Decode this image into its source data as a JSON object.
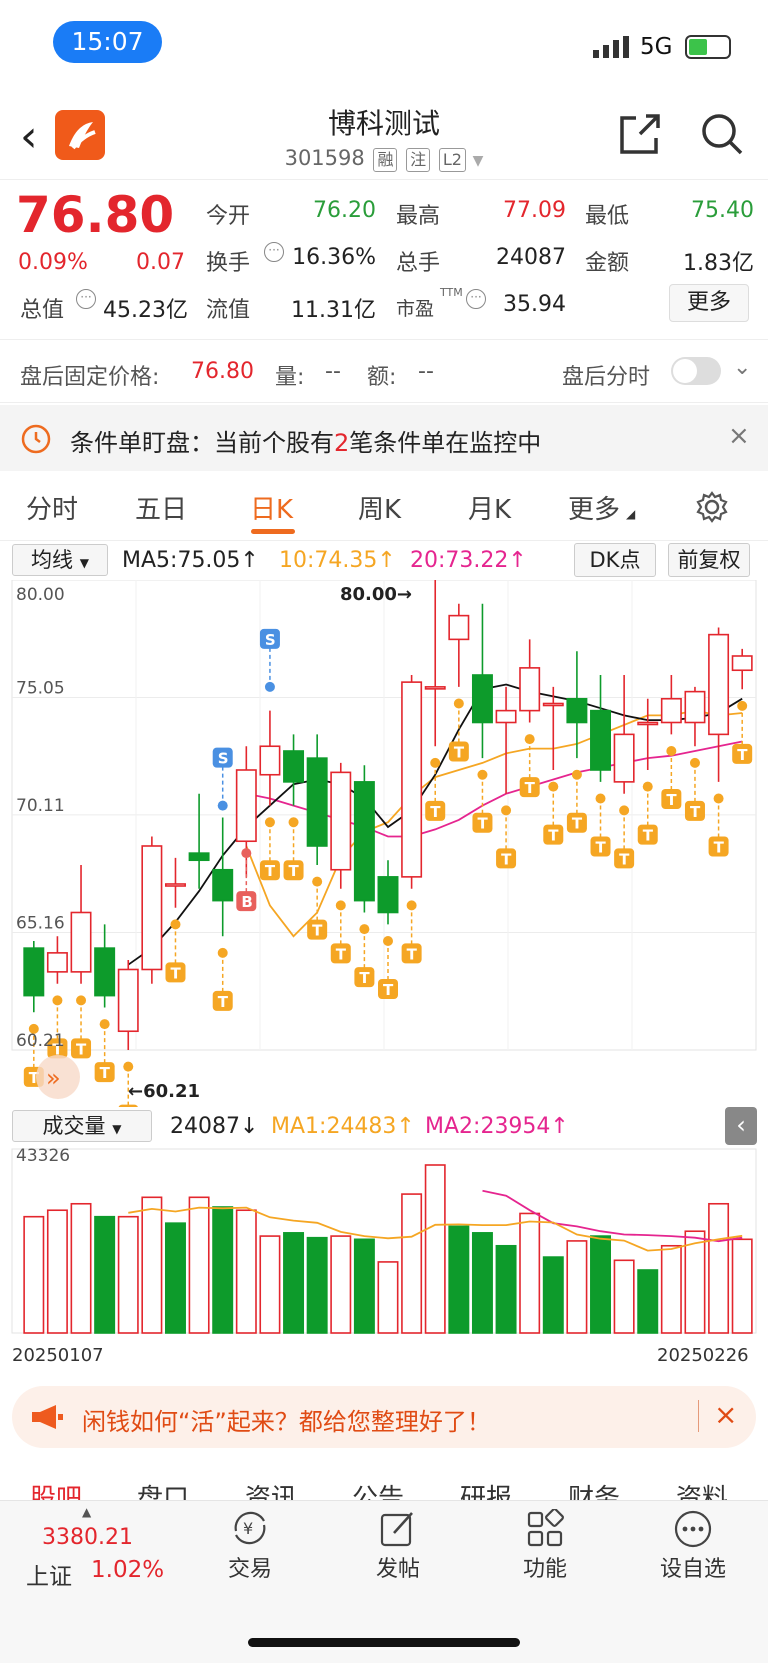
{
  "status_bar": {
    "time": "15:07",
    "network": "5G"
  },
  "header": {
    "title": "博科测试",
    "code": "301598",
    "tags": [
      "融",
      "注",
      "L2"
    ]
  },
  "quote": {
    "price": "76.80",
    "change_pct": "0.09%",
    "change": "0.07",
    "rows": [
      [
        {
          "label": "今开",
          "value": "76.20",
          "color": "#2a9d3a"
        },
        {
          "label": "最高",
          "value": "77.09",
          "color": "#e3262d"
        },
        {
          "label": "最低",
          "value": "75.40",
          "color": "#2a9d3a"
        }
      ],
      [
        {
          "label": "换手",
          "value": "16.36%",
          "color": "#222"
        },
        {
          "label": "总手",
          "value": "24087",
          "color": "#222"
        },
        {
          "label": "金额",
          "value": "1.83亿",
          "color": "#222"
        }
      ],
      [
        {
          "label": "总值",
          "value": "45.23亿",
          "color": "#222"
        },
        {
          "label": "流值",
          "value": "11.31亿",
          "color": "#222"
        },
        {
          "label": "市盈",
          "value": "35.94",
          "color": "#222"
        }
      ]
    ],
    "pe_sup": "TTM",
    "more_label": "更多"
  },
  "after_hours": {
    "label": "盘后固定价格:",
    "price": "76.80",
    "vol_label": "量:",
    "vol": "--",
    "amt_label": "额:",
    "amt": "--",
    "intraday_label": "盘后分时"
  },
  "alert": {
    "prefix": "条件单盯盘：当前个股有",
    "count": "2",
    "suffix": "笔条件单在监控中"
  },
  "tabs": [
    "分时",
    "五日",
    "日K",
    "周K",
    "月K",
    "更多"
  ],
  "active_tab": "日K",
  "ma_row": {
    "type": "均线",
    "ma5": "MA5:75.05↑",
    "ma10": "10:74.35↑",
    "ma20": "20:73.22↑",
    "dk": "DK点",
    "adjust": "前复权"
  },
  "vol_row": {
    "type": "成交量",
    "vol": "24087↓",
    "ma1": "MA1:24483↑",
    "ma2": "MA2:23954↑"
  },
  "chart_data": {
    "type": "candlestick",
    "y_ticks": [
      "80.00",
      "75.05",
      "70.11",
      "65.16",
      "60.21"
    ],
    "ylim": [
      60.21,
      80.0
    ],
    "max_label": "80.00→",
    "min_label": "←60.21",
    "x_start": "20250107",
    "x_end": "20250226",
    "candles": [
      {
        "o": 64.5,
        "c": 62.5,
        "h": 64.8,
        "l": 61.8
      },
      {
        "o": 63.5,
        "c": 64.3,
        "h": 65.0,
        "l": 63.0
      },
      {
        "o": 63.5,
        "c": 66.0,
        "h": 68.0,
        "l": 63.0
      },
      {
        "o": 64.5,
        "c": 62.5,
        "h": 65.5,
        "l": 62.0
      },
      {
        "o": 61.0,
        "c": 63.6,
        "h": 64.0,
        "l": 60.21
      },
      {
        "o": 63.6,
        "c": 68.8,
        "h": 69.2,
        "l": 63.0
      },
      {
        "o": 67.2,
        "c": 67.2,
        "h": 68.3,
        "l": 66.2
      },
      {
        "o": 68.5,
        "c": 68.2,
        "h": 71.0,
        "l": 67.0
      },
      {
        "o": 67.8,
        "c": 66.5,
        "h": 70.0,
        "l": 65.0
      },
      {
        "o": 69.0,
        "c": 72.0,
        "h": 73.0,
        "l": 67.5
      },
      {
        "o": 71.8,
        "c": 73.0,
        "h": 74.5,
        "l": 70.5
      },
      {
        "o": 72.8,
        "c": 71.5,
        "h": 73.5,
        "l": 70.5
      },
      {
        "o": 72.5,
        "c": 68.8,
        "h": 73.5,
        "l": 68.0
      },
      {
        "o": 67.8,
        "c": 71.9,
        "h": 72.3,
        "l": 67.0
      },
      {
        "o": 71.5,
        "c": 66.5,
        "h": 72.2,
        "l": 66.0
      },
      {
        "o": 67.5,
        "c": 66.0,
        "h": 68.2,
        "l": 65.5
      },
      {
        "o": 67.5,
        "c": 75.7,
        "h": 76.0,
        "l": 67.0
      },
      {
        "o": 75.5,
        "c": 75.5,
        "h": 80.0,
        "l": 73.0
      },
      {
        "o": 77.5,
        "c": 78.5,
        "h": 79.0,
        "l": 75.5
      },
      {
        "o": 76.0,
        "c": 74.0,
        "h": 79.0,
        "l": 72.5
      },
      {
        "o": 74.0,
        "c": 74.5,
        "h": 75.5,
        "l": 71.0
      },
      {
        "o": 74.5,
        "c": 76.3,
        "h": 77.5,
        "l": 74.0
      },
      {
        "o": 74.8,
        "c": 74.8,
        "h": 75.5,
        "l": 72.0
      },
      {
        "o": 75.0,
        "c": 74.0,
        "h": 77.0,
        "l": 72.5
      },
      {
        "o": 74.5,
        "c": 72.0,
        "h": 76.0,
        "l": 71.5
      },
      {
        "o": 71.5,
        "c": 73.5,
        "h": 76.0,
        "l": 71.0
      },
      {
        "o": 74.0,
        "c": 74.0,
        "h": 75.0,
        "l": 72.0
      },
      {
        "o": 74.0,
        "c": 75.0,
        "h": 76.0,
        "l": 73.5
      },
      {
        "o": 74.0,
        "c": 75.3,
        "h": 75.5,
        "l": 73.0
      },
      {
        "o": 73.5,
        "c": 77.7,
        "h": 78.0,
        "l": 71.5
      },
      {
        "o": 76.2,
        "c": 76.8,
        "h": 77.1,
        "l": 75.4
      }
    ],
    "ma5": [
      null,
      null,
      null,
      null,
      63.8,
      64.5,
      65.6,
      66.9,
      68.4,
      69.6,
      70.5,
      71.4,
      71.6,
      71.4,
      70.8,
      69.6,
      70.3,
      71.8,
      73.7,
      75.4,
      75.6,
      75.3,
      75.1,
      74.9,
      74.6,
      74.3,
      74.1,
      74.1,
      74.2,
      74.4,
      75.0
    ],
    "ma10": [
      null,
      null,
      null,
      null,
      null,
      null,
      null,
      null,
      null,
      68.8,
      66.3,
      65.0,
      66.0,
      68.3,
      69.4,
      69.8,
      70.9,
      71.7,
      72.0,
      72.3,
      72.7,
      72.9,
      72.9,
      73.1,
      73.5,
      73.9,
      74.3,
      74.3,
      74.5,
      74.3,
      74.4
    ],
    "ma20": [
      null,
      null,
      null,
      null,
      null,
      null,
      null,
      null,
      null,
      71.0,
      70.8,
      70.5,
      70.2,
      69.9,
      69.6,
      69.2,
      69.2,
      69.5,
      69.9,
      70.5,
      71.0,
      71.3,
      71.6,
      71.9,
      72.1,
      72.3,
      72.5,
      72.6,
      72.8,
      73.0,
      73.2
    ],
    "volume": {
      "ylabel": "43326",
      "bars": [
        {
          "v": 36000,
          "up": true
        },
        {
          "v": 38000,
          "up": true
        },
        {
          "v": 40000,
          "up": true
        },
        {
          "v": 36000,
          "up": false
        },
        {
          "v": 36000,
          "up": true
        },
        {
          "v": 42000,
          "up": true
        },
        {
          "v": 34000,
          "up": false
        },
        {
          "v": 42000,
          "up": true
        },
        {
          "v": 39000,
          "up": false
        },
        {
          "v": 38000,
          "up": true
        },
        {
          "v": 30000,
          "up": true
        },
        {
          "v": 31000,
          "up": false
        },
        {
          "v": 29500,
          "up": false
        },
        {
          "v": 30000,
          "up": true
        },
        {
          "v": 29000,
          "up": false
        },
        {
          "v": 22000,
          "up": true
        },
        {
          "v": 43000,
          "up": true
        },
        {
          "v": 52000,
          "up": true
        },
        {
          "v": 33000,
          "up": false
        },
        {
          "v": 31000,
          "up": false
        },
        {
          "v": 27000,
          "up": false
        },
        {
          "v": 37000,
          "up": true
        },
        {
          "v": 23500,
          "up": false
        },
        {
          "v": 28500,
          "up": true
        },
        {
          "v": 30000,
          "up": false
        },
        {
          "v": 22500,
          "up": true
        },
        {
          "v": 19500,
          "up": false
        },
        {
          "v": 27000,
          "up": true
        },
        {
          "v": 31500,
          "up": true
        },
        {
          "v": 40000,
          "up": true
        },
        {
          "v": 29000,
          "up": true
        }
      ],
      "ma1": [
        null,
        null,
        null,
        null,
        37200,
        38400,
        37600,
        38800,
        38600,
        38800,
        35800,
        34800,
        34100,
        31300,
        30000,
        29300,
        29800,
        33500,
        33600,
        33400,
        33400,
        34500,
        34200,
        30500,
        29200,
        28600,
        25500,
        26000,
        27800,
        29000,
        30100
      ],
      "ma2": [
        null,
        null,
        null,
        null,
        null,
        null,
        null,
        null,
        null,
        null,
        null,
        null,
        null,
        null,
        null,
        null,
        null,
        null,
        null,
        44000,
        42500,
        38000,
        34000,
        33000,
        31500,
        30500,
        30300,
        30000,
        29500,
        28400,
        29500
      ]
    },
    "signals": [
      "S",
      "S",
      "B"
    ]
  },
  "promo": {
    "text": "闲钱如何“活”起来？都给您整理好了！"
  },
  "sub_tabs": [
    "股吧",
    "盘口",
    "资讯",
    "公告",
    "研报",
    "财务",
    "资料"
  ],
  "bottom_bar": {
    "index_value": "3380.21",
    "index_name": "上证",
    "index_pct": "1.02%",
    "items": [
      "交易",
      "发帖",
      "功能",
      "设自选"
    ]
  }
}
